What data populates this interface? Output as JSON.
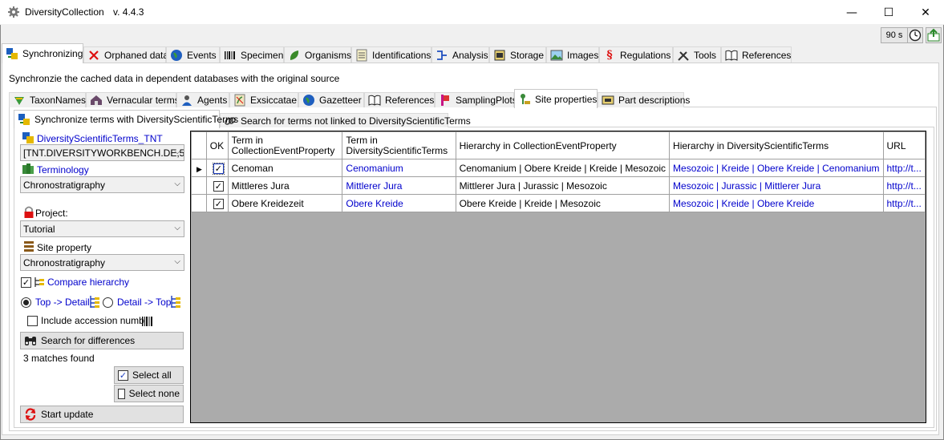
{
  "window": {
    "title": "DiversityCollection",
    "version": "v. 4.4.3",
    "minimize_glyph": "—",
    "maximize_glyph": "☐",
    "close_glyph": "✕"
  },
  "toolbar": {
    "timer_label": "90 s",
    "clock_icon": "clock-icon",
    "export_icon": "export-icon"
  },
  "main_tabs": [
    {
      "label": "Synchronizing",
      "icon": "sync-icon",
      "active": true
    },
    {
      "label": "Orphaned data",
      "icon": "red-x-icon"
    },
    {
      "label": "Events",
      "icon": "globe-icon"
    },
    {
      "label": "Specimen",
      "icon": "barcode-icon"
    },
    {
      "label": "Organisms",
      "icon": "leaf-icon"
    },
    {
      "label": "Identifications",
      "icon": "list-icon"
    },
    {
      "label": "Analysis",
      "icon": "analysis-icon"
    },
    {
      "label": "Storage",
      "icon": "storage-icon"
    },
    {
      "label": "Images",
      "icon": "image-icon"
    },
    {
      "label": "Regulations",
      "icon": "paragraph-icon"
    },
    {
      "label": "Tools",
      "icon": "tools-icon"
    },
    {
      "label": "References",
      "icon": "book-icon"
    }
  ],
  "description": "Synchronzie the cached data in dependent databases with the original source",
  "sub_tabs": [
    {
      "label": "TaxonNames",
      "icon": "taxon-icon"
    },
    {
      "label": "Vernacular terms",
      "icon": "house-icon"
    },
    {
      "label": "Agents",
      "icon": "agent-icon"
    },
    {
      "label": "Exsiccatae",
      "icon": "exsiccatae-icon"
    },
    {
      "label": "Gazetteer",
      "icon": "globe-icon"
    },
    {
      "label": "References",
      "icon": "book-icon"
    },
    {
      "label": "SamplingPlots",
      "icon": "samplingplot-icon"
    },
    {
      "label": "Site properties",
      "icon": "site-icon",
      "active": true
    },
    {
      "label": "Part descriptions",
      "icon": "part-icon"
    }
  ],
  "inner_tabs": [
    {
      "label": "Synchronize terms with DiversityScientificTerms",
      "icon": "sync-icon",
      "active": true
    },
    {
      "label": "Search for terms not linked to DiversityScientificTerms",
      "icon": "link-icon"
    }
  ],
  "left": {
    "source_label": "DiversityScientificTerms_TNT",
    "source_value": "[TNT.DIVERSITYWORKBENCH.DE,5",
    "terminology_label": "Terminology",
    "terminology_value": "Chronostratigraphy",
    "project_label": "Project:",
    "project_value": "Tutorial",
    "site_property_label": "Site property",
    "site_property_value": "Chronostratigraphy",
    "compare_hierarchy_label": "Compare hierarchy",
    "compare_hierarchy_checked": true,
    "top_detail_label": "Top -> Detail",
    "detail_top_label": "Detail -> Top",
    "include_accession_label": "Include accession numb",
    "search_button": "Search for differences",
    "matches": "3 matches found",
    "select_all": "Select all",
    "select_none": "Select none",
    "start_update": "Start update"
  },
  "grid": {
    "headers": {
      "ok": "OK",
      "term_cep": "Term in CollectionEventProperty",
      "term_dst": "Term in DiversityScientificTerms",
      "hier_cep": "Hierarchy in CollectionEventProperty",
      "hier_dst": "Hierarchy in DiversityScientificTerms",
      "url": "URL"
    },
    "term_cep_l1": "Term in",
    "term_cep_l2": "CollectionEventProperty",
    "term_dst_l1": "Term in",
    "term_dst_l2": "DiversityScientificTerms",
    "rows": [
      {
        "current": true,
        "ok": true,
        "term_cep": "Cenoman",
        "term_dst": "Cenomanium",
        "hier_cep": "Cenomanium | Obere Kreide | Kreide | Mesozoic",
        "hier_dst": "Mesozoic | Kreide | Obere Kreide | Cenomanium",
        "url": "http://t..."
      },
      {
        "current": false,
        "ok": true,
        "term_cep": "Mittleres Jura",
        "term_dst": "Mittlerer Jura",
        "hier_cep": "Mittlerer Jura | Jurassic | Mesozoic",
        "hier_dst": "Mesozoic | Jurassic | Mittlerer Jura",
        "url": "http://t..."
      },
      {
        "current": false,
        "ok": true,
        "term_cep": "Obere Kreidezeit",
        "term_dst": "Obere Kreide",
        "hier_cep": "Obere Kreide | Kreide | Mesozoic",
        "hier_dst": "Mesozoic | Kreide | Obere Kreide",
        "url": "http://t..."
      }
    ]
  }
}
